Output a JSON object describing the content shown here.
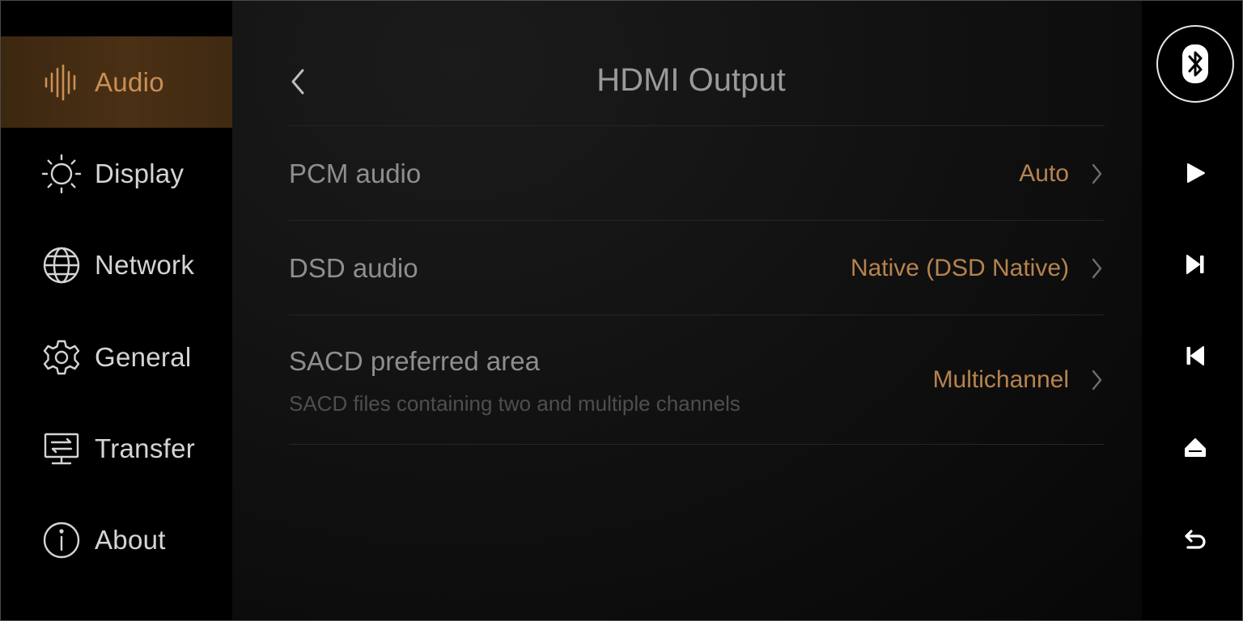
{
  "sidebar": {
    "items": [
      {
        "label": "Audio",
        "icon": "waveform-icon",
        "active": true
      },
      {
        "label": "Display",
        "icon": "sun-icon",
        "active": false
      },
      {
        "label": "Network",
        "icon": "globe-icon",
        "active": false
      },
      {
        "label": "General",
        "icon": "gear-icon",
        "active": false
      },
      {
        "label": "Transfer",
        "icon": "transfer-icon",
        "active": false
      },
      {
        "label": "About",
        "icon": "info-icon",
        "active": false
      }
    ]
  },
  "header": {
    "title": "HDMI Output",
    "back_icon": "chevron-left-icon"
  },
  "settings": [
    {
      "label": "PCM audio",
      "value": "Auto"
    },
    {
      "label": "DSD audio",
      "value": "Native (DSD Native)"
    },
    {
      "label": "SACD preferred area",
      "sublabel": "SACD files containing two and multiple channels",
      "value": "Multichannel"
    }
  ],
  "controls": {
    "icons": [
      "bluetooth-icon",
      "play-icon",
      "next-track-icon",
      "previous-track-icon",
      "eject-icon",
      "return-icon"
    ]
  },
  "colors": {
    "accent": "#c98f55",
    "value_text": "#b7834e",
    "active_bg": "#4a3014"
  }
}
